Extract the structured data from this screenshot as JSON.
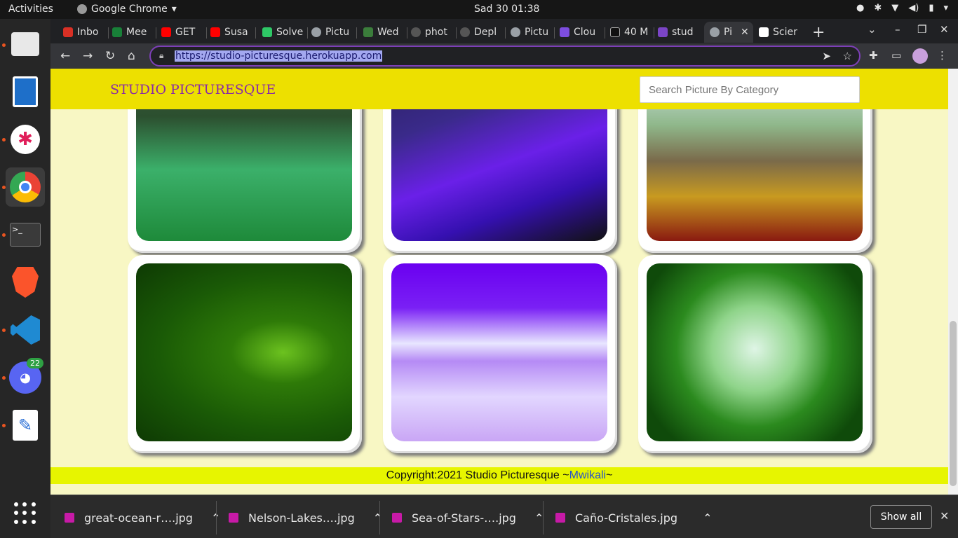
{
  "system": {
    "activities": "Activities",
    "app_name": "Google Chrome",
    "clock": "Sad 30  01:38",
    "dock_badge": "22"
  },
  "tabs": [
    {
      "label": "Inbo",
      "color": "#d93025"
    },
    {
      "label": "Mee",
      "color": "#188038"
    },
    {
      "label": "GET",
      "color": "#ff0000"
    },
    {
      "label": "Susa",
      "color": "#ff0000"
    },
    {
      "label": "Solve",
      "color": "#2ec866"
    },
    {
      "label": "Pictu",
      "color": "#9aa0a6"
    },
    {
      "label": "Wed",
      "color": "#3b7d3b"
    },
    {
      "label": "phot",
      "color": "#555555"
    },
    {
      "label": "Depl",
      "color": "#555555"
    },
    {
      "label": "Pictu",
      "color": "#9aa0a6"
    },
    {
      "label": "Clou",
      "color": "#7d4de0"
    },
    {
      "label": "40 M",
      "color": "#111111"
    },
    {
      "label": "stud",
      "color": "#7b45c6"
    },
    {
      "label": "Pi",
      "color": "#9aa0a6"
    },
    {
      "label": "Scier",
      "color": "#ffffff"
    }
  ],
  "address_bar": {
    "url": "https://studio-picturesque.herokuapp.com"
  },
  "site": {
    "brand": "STUDIO PICTURESQUE",
    "search_placeholder": "Search Picture By Category",
    "footer_text": "Copyright:2021 Studio Picturesque ~",
    "footer_link": "Mwikali",
    "footer_end": "~"
  },
  "downloads": {
    "items": [
      "great-ocean-r….jpg",
      "Nelson-Lakes….jpg",
      "Sea-of-Stars-….jpg",
      "Caño-Cristales.jpg"
    ],
    "show_all": "Show all"
  }
}
